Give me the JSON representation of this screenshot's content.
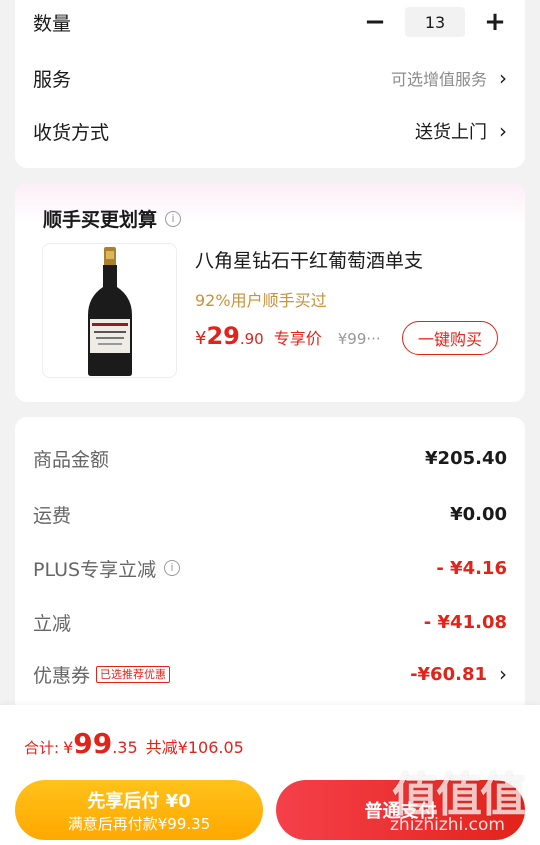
{
  "options": {
    "quantity": {
      "label": "数量",
      "value": "13",
      "minus": "−",
      "plus": "+"
    },
    "service": {
      "label": "服务",
      "value": "可选增值服务",
      "chevron": "›"
    },
    "delivery": {
      "label": "收货方式",
      "value": "送货上门",
      "chevron": "›"
    }
  },
  "upsell": {
    "title": "顺手买更划算",
    "info_icon": "i",
    "product": {
      "name": "八角星钻石干红葡萄酒单支",
      "subtitle": "92%用户顺手买过",
      "price_symbol": "¥",
      "price_int": "29",
      "price_dec": ".90",
      "price_tag": "专享价",
      "original_price": "¥99···",
      "buy_label": "一键购买",
      "image_label": "HERMANTS DIAMOND ÉTOILES"
    }
  },
  "price_summary": {
    "goods": {
      "label": "商品金额",
      "value": "¥205.40"
    },
    "shipping": {
      "label": "运费",
      "value": "¥0.00"
    },
    "plus": {
      "label": "PLUS专享立减",
      "value": "- ¥4.16"
    },
    "discount": {
      "label": "立减",
      "value": "- ¥41.08"
    },
    "coupon": {
      "label": "优惠券",
      "tag": "已选推荐优惠",
      "value": "-¥60.81",
      "chevron": "›"
    }
  },
  "bottom": {
    "total_label": "合计:",
    "total_symbol": "¥",
    "total_int": "99",
    "total_dec": ".35",
    "saved": "共减¥106.05",
    "pay_later_line1": "先享后付 ¥0",
    "pay_later_line2": "满意后再付款¥99.35",
    "pay_button": "普通支付"
  },
  "watermark": {
    "mark": "值值值",
    "url": "zhizhizhi.com"
  },
  "colors": {
    "accent_red": "#e2231a",
    "gold": "#c8923a",
    "pay_later_yellow": "#ffb300"
  }
}
